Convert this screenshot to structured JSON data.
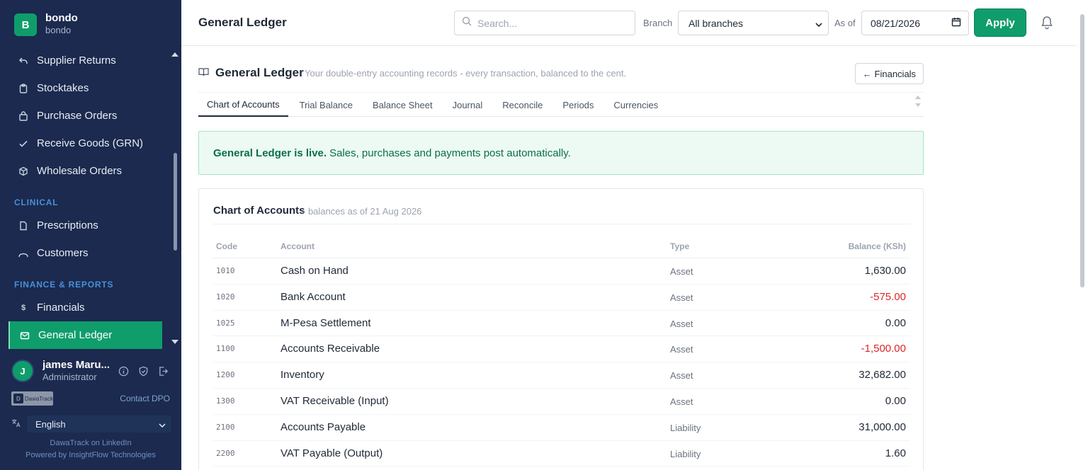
{
  "brand": {
    "logo_letter": "B",
    "name": "bondo",
    "sub": "bondo"
  },
  "sidebar": {
    "items_top": [
      {
        "label": "Supplier Returns",
        "icon": "return-arrow-icon"
      },
      {
        "label": "Stocktakes",
        "icon": "clipboard-icon"
      },
      {
        "label": "Purchase Orders",
        "icon": "bag-icon"
      },
      {
        "label": "Receive Goods (GRN)",
        "icon": "check-icon"
      },
      {
        "label": "Wholesale Orders",
        "icon": "box-icon"
      }
    ],
    "section_clinical": "CLINICAL",
    "items_clinical": [
      {
        "label": "Prescriptions",
        "icon": "document-icon"
      },
      {
        "label": "Customers",
        "icon": "users-icon"
      }
    ],
    "section_finance": "FINANCE & REPORTS",
    "items_finance": [
      {
        "label": "Financials",
        "icon": "dollar-icon"
      },
      {
        "label": "General Ledger",
        "icon": "ledger-icon",
        "active": true
      }
    ]
  },
  "user": {
    "initial": "J",
    "name": "james Maru...",
    "role": "Administrator"
  },
  "footer": {
    "logo_text": "DawaTrack",
    "contact_dpo": "Contact DPO",
    "language": "English",
    "linkedin": "DawaTrack on LinkedIn",
    "powered_by": "Powered by InsightFlow Technologies"
  },
  "topbar": {
    "title": "General Ledger",
    "search_placeholder": "Search...",
    "branch_label": "Branch",
    "branch_value": "All branches",
    "asof_label": "As of",
    "asof_value": "08/21/2026",
    "apply_label": "Apply"
  },
  "main": {
    "title": "General Ledger",
    "subtitle": "Your double-entry accounting records - every transaction, balanced to the cent.",
    "financials_button": "← Financials",
    "tabs": [
      "Chart of Accounts",
      "Trial Balance",
      "Balance Sheet",
      "Journal",
      "Reconcile",
      "Periods",
      "Currencies"
    ],
    "alert_bold": "General Ledger is live.",
    "alert_text": "Sales, purchases and payments post automatically."
  },
  "table": {
    "title": "Chart of Accounts",
    "subtitle": "- balances as of 21 Aug 2026",
    "headers": {
      "code": "Code",
      "account": "Account",
      "type": "Type",
      "balance": "Balance (KSh)"
    },
    "rows": [
      {
        "code": "1010",
        "account": "Cash on Hand",
        "type": "Asset",
        "balance": "1,630.00",
        "negative": false
      },
      {
        "code": "1020",
        "account": "Bank Account",
        "type": "Asset",
        "balance": "-575.00",
        "negative": true
      },
      {
        "code": "1025",
        "account": "M-Pesa Settlement",
        "type": "Asset",
        "balance": "0.00",
        "negative": false
      },
      {
        "code": "1100",
        "account": "Accounts Receivable",
        "type": "Asset",
        "balance": "-1,500.00",
        "negative": true
      },
      {
        "code": "1200",
        "account": "Inventory",
        "type": "Asset",
        "balance": "32,682.00",
        "negative": false
      },
      {
        "code": "1300",
        "account": "VAT Receivable (Input)",
        "type": "Asset",
        "balance": "0.00",
        "negative": false
      },
      {
        "code": "2100",
        "account": "Accounts Payable",
        "type": "Liability",
        "balance": "31,000.00",
        "negative": false
      },
      {
        "code": "2200",
        "account": "VAT Payable (Output)",
        "type": "Liability",
        "balance": "1.60",
        "negative": false
      }
    ]
  },
  "colors": {
    "sidebar_bg": "#1b2a4e",
    "accent": "#0f9d6c",
    "negative": "#dc2626"
  }
}
